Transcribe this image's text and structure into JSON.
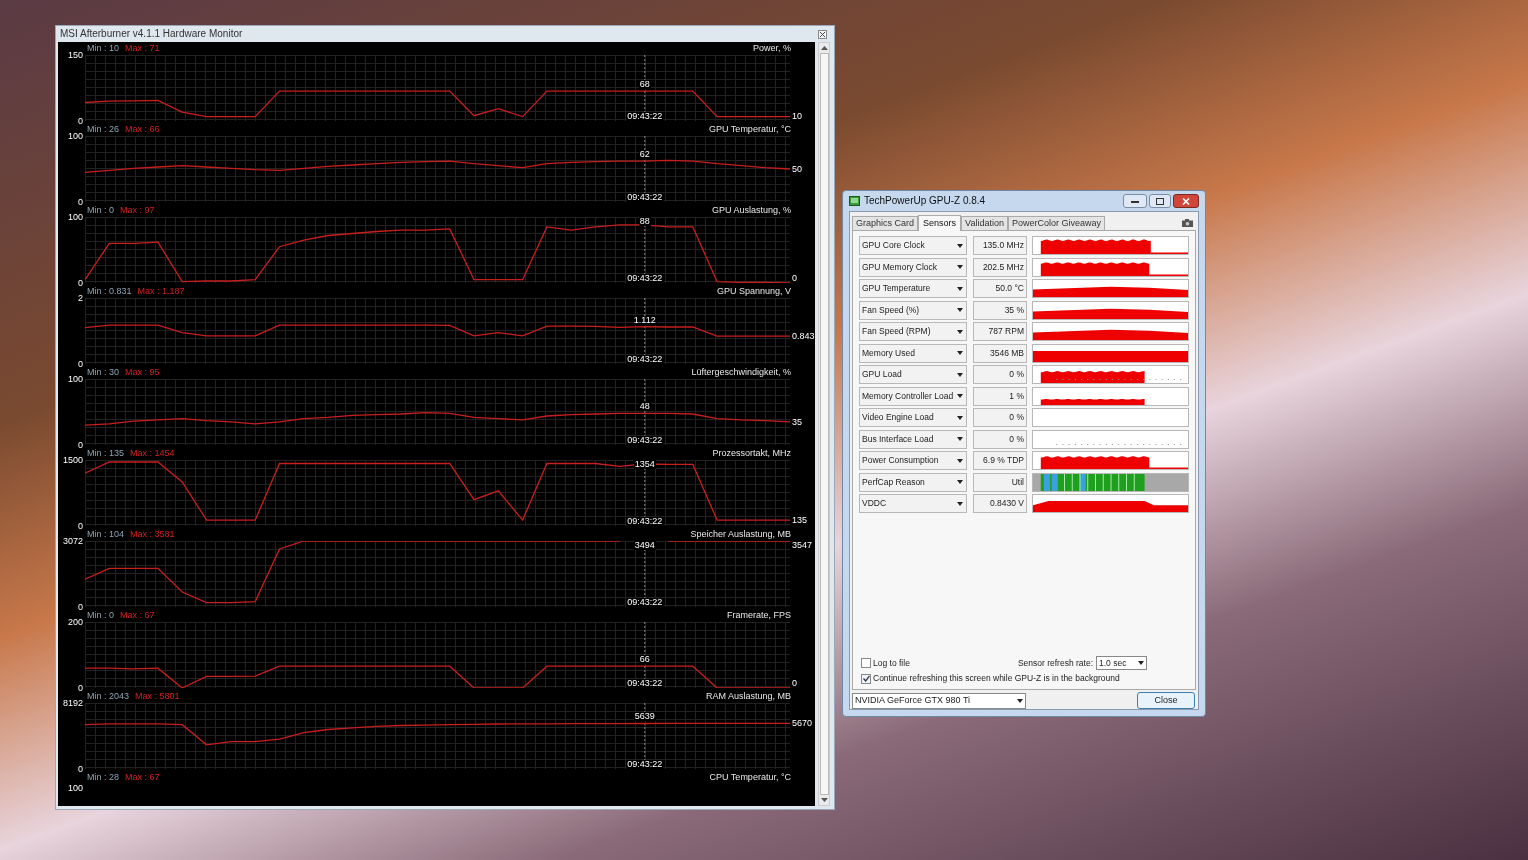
{
  "monitor": {
    "title": "MSI Afterburner v4.1.1 Hardware Monitor",
    "panels": [
      {
        "min": "Min : 10",
        "max": "Max : 71",
        "cursor_value": "68",
        "cursor_time": "09:43:22",
        "current_value": "10",
        "chart_data": {
          "type": "line",
          "grid": true,
          "ylim": [
            0,
            150
          ],
          "yticks": [
            0,
            150
          ],
          "series": [
            {
              "name": "Power, %",
              "color": "#c81e1e",
              "values": [
                42,
                45,
                46,
                47,
                20,
                10,
                10,
                10,
                68,
                68,
                68,
                68,
                68,
                68,
                68,
                68,
                12,
                28,
                10,
                68,
                68,
                68,
                68,
                68,
                68,
                68,
                10,
                10,
                10,
                10
              ]
            }
          ]
        }
      },
      {
        "min": "Min : 26",
        "max": "Max : 66",
        "cursor_value": "62",
        "cursor_time": "09:43:22",
        "current_value": "50",
        "chart_data": {
          "type": "line",
          "grid": true,
          "ylim": [
            0,
            100
          ],
          "yticks": [
            0,
            100
          ],
          "series": [
            {
              "name": "GPU Temperatur, °C",
              "color": "#c81e1e",
              "values": [
                45,
                48,
                51,
                53,
                55,
                53,
                51,
                49,
                48,
                51,
                54,
                56,
                58,
                60,
                61,
                62,
                58,
                55,
                52,
                58,
                60,
                61,
                62,
                62,
                63,
                62,
                58,
                55,
                52,
                50
              ]
            }
          ]
        }
      },
      {
        "min": "Min : 0",
        "max": "Max : 97",
        "cursor_value": "88",
        "cursor_time": "09:43:22",
        "current_value": "0",
        "chart_data": {
          "type": "line",
          "grid": true,
          "ylim": [
            0,
            100
          ],
          "yticks": [
            0,
            100
          ],
          "series": [
            {
              "name": "GPU Auslastung, %",
              "color": "#c81e1e",
              "values": [
                5,
                60,
                60,
                62,
                2,
                3,
                3,
                5,
                55,
                65,
                72,
                75,
                78,
                80,
                80,
                82,
                5,
                5,
                5,
                85,
                80,
                85,
                88,
                88,
                85,
                85,
                2,
                1,
                1,
                0
              ]
            }
          ]
        }
      },
      {
        "min": "Min : 0.831",
        "max": "Max : 1.187",
        "cursor_value": "1.112",
        "cursor_time": "09:43:22",
        "current_value": "0.843",
        "chart_data": {
          "type": "line",
          "grid": true,
          "ylim": [
            0,
            2
          ],
          "yticks": [
            0,
            2
          ],
          "series": [
            {
              "name": "GPU Spannung, V",
              "color": "#c81e1e",
              "values": [
                1.1,
                1.18,
                1.18,
                1.18,
                0.95,
                0.85,
                0.85,
                0.85,
                1.18,
                1.18,
                1.18,
                1.18,
                1.18,
                1.18,
                1.18,
                1.17,
                0.85,
                0.95,
                0.85,
                1.15,
                1.15,
                1.14,
                1.112,
                1.13,
                1.12,
                1.12,
                0.843,
                0.843,
                0.843,
                0.843
              ]
            }
          ]
        }
      },
      {
        "min": "Min : 30",
        "max": "Max : 95",
        "cursor_value": "48",
        "cursor_time": "09:43:22",
        "current_value": "35",
        "chart_data": {
          "type": "line",
          "grid": true,
          "ylim": [
            0,
            100
          ],
          "yticks": [
            0,
            100
          ],
          "series": [
            {
              "name": "Lüftergeschwindigkeit, %",
              "color": "#c81e1e",
              "values": [
                30,
                32,
                36,
                38,
                40,
                37,
                35,
                32,
                35,
                40,
                42,
                45,
                46,
                47,
                49,
                48,
                42,
                40,
                38,
                44,
                46,
                47,
                48,
                48,
                48,
                47,
                40,
                38,
                37,
                35
              ]
            }
          ]
        }
      },
      {
        "min": "Min : 135",
        "max": "Max : 1454",
        "cursor_value": "1354",
        "cursor_time": "09:43:22",
        "current_value": "135",
        "chart_data": {
          "type": "line",
          "grid": true,
          "ylim": [
            0,
            1500
          ],
          "yticks": [
            0,
            1500
          ],
          "series": [
            {
              "name": "Prozessortakt, MHz",
              "color": "#c81e1e",
              "values": [
                1200,
                1454,
                1454,
                1454,
                1000,
                135,
                135,
                135,
                1420,
                1420,
                1420,
                1420,
                1420,
                1420,
                1420,
                1420,
                600,
                800,
                135,
                1420,
                1420,
                1420,
                1354,
                1410,
                1400,
                1400,
                135,
                135,
                135,
                135
              ]
            }
          ]
        }
      },
      {
        "min": "Min : 104",
        "max": "Max : 3581",
        "cursor_value": "3494",
        "cursor_time": "09:43:22",
        "current_value": "3547",
        "chart_data": {
          "type": "line",
          "grid": true,
          "ylim": [
            0,
            3072
          ],
          "yticks": [
            0,
            3072
          ],
          "series": [
            {
              "name": "Speicher Auslastung, MB",
              "color": "#c81e1e",
              "values": [
                1300,
                1800,
                1800,
                1800,
                700,
                200,
                200,
                250,
                2700,
                3072,
                3072,
                3072,
                3072,
                3072,
                3072,
                3072,
                3072,
                3072,
                3072,
                3072,
                3072,
                3072,
                3072,
                null,
                3072,
                3072,
                3072,
                3072,
                3072,
                3072
              ]
            }
          ]
        }
      },
      {
        "min": "Min : 0",
        "max": "Max : 67",
        "cursor_value": "66",
        "cursor_time": "09:43:22",
        "current_value": "0",
        "chart_data": {
          "type": "line",
          "grid": true,
          "ylim": [
            0,
            200
          ],
          "yticks": [
            0,
            200
          ],
          "series": [
            {
              "name": "Framerate, FPS",
              "color": "#c81e1e",
              "values": [
                60,
                60,
                58,
                60,
                0,
                35,
                35,
                36,
                66,
                66,
                66,
                66,
                66,
                66,
                66,
                66,
                0,
                0,
                0,
                66,
                66,
                66,
                66,
                66,
                66,
                66,
                0,
                0,
                0,
                0
              ]
            }
          ]
        }
      },
      {
        "min": "Min : 2043",
        "max": "Max : 5801",
        "cursor_value": "5639",
        "cursor_time": "09:43:22",
        "current_value": "5670",
        "chart_data": {
          "type": "line",
          "grid": true,
          "ylim": [
            0,
            8192
          ],
          "yticks": [
            0,
            8192
          ],
          "series": [
            {
              "name": "RAM Auslastung, MB",
              "color": "#c81e1e",
              "values": [
                5500,
                5600,
                5600,
                5600,
                5500,
                3000,
                3400,
                3400,
                3700,
                4500,
                4900,
                5100,
                5300,
                5400,
                5450,
                5500,
                5550,
                5580,
                5600,
                5610,
                5620,
                5630,
                5639,
                5650,
                5660,
                5665,
                5670,
                5670,
                5670,
                5670
              ]
            }
          ]
        }
      },
      {
        "min": "Min : 28",
        "max": "Max : 67",
        "title": "CPU Temperatur, °C",
        "top_tick": "100"
      }
    ]
  },
  "gpuz": {
    "title": "TechPowerUp GPU-Z 0.8.4",
    "tabs": [
      {
        "label": "Graphics Card",
        "selected": false
      },
      {
        "label": "Sensors",
        "selected": true
      },
      {
        "label": "Validation",
        "selected": false
      },
      {
        "label": "PowerColor Giveaway",
        "selected": false
      }
    ],
    "sensors": [
      {
        "name": "GPU Core Clock",
        "value": "135.0 MHz",
        "kind": "clock"
      },
      {
        "name": "GPU Memory Clock",
        "value": "202.5 MHz",
        "kind": "memclock"
      },
      {
        "name": "GPU Temperature",
        "value": "50.0 °C",
        "kind": "level"
      },
      {
        "name": "Fan Speed (%)",
        "value": "35 %",
        "kind": "level"
      },
      {
        "name": "Fan Speed (RPM)",
        "value": "787 RPM",
        "kind": "level"
      },
      {
        "name": "Memory Used",
        "value": "3546 MB",
        "kind": "full"
      },
      {
        "name": "GPU Load",
        "value": "0 %",
        "kind": "load"
      },
      {
        "name": "Memory Controller Load",
        "value": "1 %",
        "kind": "lowload"
      },
      {
        "name": "Video Engine Load",
        "value": "0 %",
        "kind": "empty"
      },
      {
        "name": "Bus Interface Load",
        "value": "0 %",
        "kind": "sparse"
      },
      {
        "name": "Power Consumption",
        "value": "6.9 % TDP",
        "kind": "power"
      },
      {
        "name": "PerfCap Reason",
        "value": "Util",
        "kind": "perfcap"
      },
      {
        "name": "VDDC",
        "value": "0.8430 V",
        "kind": "vddc"
      }
    ],
    "log_to_file": {
      "label": "Log to file",
      "checked": false
    },
    "refresh": {
      "label": "Sensor refresh rate:",
      "value": "1.0 sec"
    },
    "continue_refreshing": {
      "label": "Continue refreshing this screen while GPU-Z is in the background",
      "checked": true
    },
    "device": "NVIDIA GeForce GTX 980 Ti",
    "close_button": "Close"
  }
}
